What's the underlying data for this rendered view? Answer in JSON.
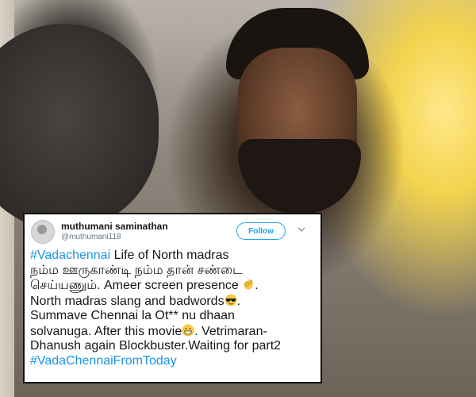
{
  "tweet": {
    "display_name": "muthumani saminathan",
    "handle": "@muthumani118",
    "follow_label": "Follow",
    "lines": {
      "l1_hashtag": "#Vadachennai",
      "l1_text": " Life of North madras",
      "l2": "நம்ம ஊருகாண்டி நம்ம தான் சண்டை",
      "l3": "செய்யணும். Ameer screen presence ",
      "l3_end": ".",
      "l4": "North madras slang and badwords",
      "l4_end": ".",
      "l5": "Summave Chennai la Ot** nu dhaan",
      "l6a": "solvanuga. After this movie",
      "l6b": ".  Vetrimaran-",
      "l7": "Dhanush again Blockbuster.Waiting for part2",
      "l8_hashtag": "#VadaChennaiFromToday"
    },
    "icons": {
      "avatar": "avatar",
      "more": "chevron-down-icon",
      "emoji1": "ok-hand-emoji",
      "emoji2": "sunglasses-emoji",
      "emoji3": "grin-emoji"
    },
    "colors": {
      "link": "#1b95e0",
      "follow": "#1da1f2",
      "text": "#14171a",
      "handle": "#657786"
    }
  }
}
